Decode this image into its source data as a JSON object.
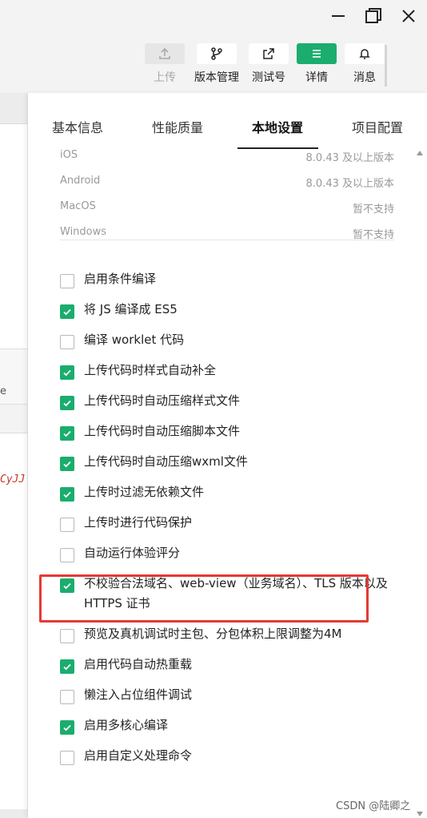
{
  "toolbar": {
    "upload": "上传",
    "version": "版本管理",
    "test": "测试号",
    "detail": "详情",
    "message": "消息"
  },
  "tabs": {
    "basic": "基本信息",
    "perf": "性能质量",
    "local": "本地设置",
    "project": "项目配置"
  },
  "libs": [
    {
      "name": "iOS",
      "value": "8.0.43 及以上版本"
    },
    {
      "name": "Android",
      "value": "8.0.43 及以上版本"
    },
    {
      "name": "MacOS",
      "value": "暂不支持"
    },
    {
      "name": "Windows",
      "value": "暂不支持"
    }
  ],
  "options": [
    {
      "label": "启用条件编译",
      "checked": false
    },
    {
      "label": "将 JS 编译成 ES5",
      "checked": true
    },
    {
      "label": "编译 worklet 代码",
      "checked": false
    },
    {
      "label": "上传代码时样式自动补全",
      "checked": true
    },
    {
      "label": "上传代码时自动压缩样式文件",
      "checked": true
    },
    {
      "label": "上传代码时自动压缩脚本文件",
      "checked": true
    },
    {
      "label": "上传代码时自动压缩wxml文件",
      "checked": true
    },
    {
      "label": "上传时过滤无依赖文件",
      "checked": true
    },
    {
      "label": "上传时进行代码保护",
      "checked": false
    },
    {
      "label": "自动运行体验评分",
      "checked": false
    },
    {
      "label": "不校验合法域名、web-view（业务域名）、TLS 版本以及 HTTPS 证书",
      "checked": true
    },
    {
      "label": "预览及真机调试时主包、分包体积上限调整为4M",
      "checked": false
    },
    {
      "label": "启用代码自动热重载",
      "checked": true
    },
    {
      "label": "懒注入占位组件调试",
      "checked": false
    },
    {
      "label": "启用多核心编译",
      "checked": true
    },
    {
      "label": "启用自定义处理命令",
      "checked": false
    }
  ],
  "left_pane": {
    "fragment": "e",
    "code_fragment": "CyJJ"
  },
  "watermark": "CSDN @陆卿之",
  "colors": {
    "accent": "#1aad6e",
    "highlight": "#e53935"
  }
}
